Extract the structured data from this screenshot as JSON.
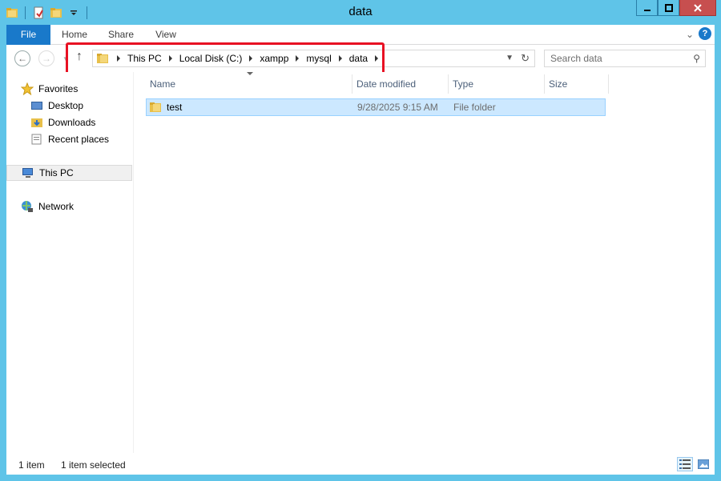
{
  "window": {
    "title": "data"
  },
  "quick_access_toolbar": {
    "icons": [
      "folder-icon",
      "properties-icon",
      "new-folder-icon",
      "customize-dropdown-icon"
    ]
  },
  "ribbon": {
    "tabs": [
      {
        "label": "File"
      },
      {
        "label": "Home"
      },
      {
        "label": "Share"
      },
      {
        "label": "View"
      }
    ],
    "help_label": "?"
  },
  "address": {
    "breadcrumbs": [
      "This PC",
      "Local Disk (C:)",
      "xampp",
      "mysql",
      "data"
    ],
    "search_placeholder": "Search data"
  },
  "navigation": {
    "favorites_label": "Favorites",
    "favorites": [
      "Desktop",
      "Downloads",
      "Recent places"
    ],
    "this_pc_label": "This PC",
    "network_label": "Network"
  },
  "files": {
    "columns": [
      "Name",
      "Date modified",
      "Type",
      "Size"
    ],
    "rows": [
      {
        "name": "test",
        "date_modified": "9/28/2025 9:15 AM",
        "type": "File folder",
        "size": ""
      }
    ]
  },
  "status": {
    "item_count": "1 item",
    "selection": "1 item selected"
  },
  "colors": {
    "window_frame": "#5fc4e8",
    "file_tab": "#1979ca",
    "selection": "#cce8ff",
    "highlight_annotation": "#e81123",
    "close_button": "#c74f4f"
  }
}
